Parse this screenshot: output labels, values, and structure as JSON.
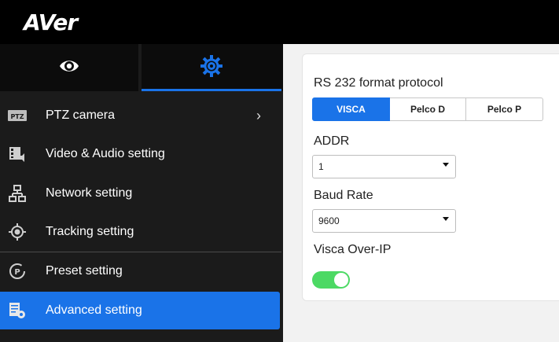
{
  "header": {
    "logo_text": "AVer"
  },
  "mode_tabs": [
    {
      "icon": "eye-icon",
      "active": false
    },
    {
      "icon": "gear-icon",
      "active": true
    }
  ],
  "sidebar": {
    "items": [
      {
        "label": "PTZ camera",
        "icon": "ptz-icon",
        "has_chevron": true
      },
      {
        "label": "Video & Audio setting",
        "icon": "video-audio-icon"
      },
      {
        "label": "Network setting",
        "icon": "network-icon"
      },
      {
        "label": "Tracking setting",
        "icon": "tracking-icon"
      },
      {
        "label": "Preset setting",
        "icon": "preset-icon"
      },
      {
        "label": "Advanced setting",
        "icon": "advanced-setting-icon",
        "active": true
      }
    ],
    "chevron": "›"
  },
  "form": {
    "protocol_label": "RS 232 format protocol",
    "protocol_options": [
      "VISCA",
      "Pelco D",
      "Pelco P"
    ],
    "protocol_selected": "VISCA",
    "addr_label": "ADDR",
    "addr_value": "1",
    "baud_label": "Baud Rate",
    "baud_value": "9600",
    "visca_ip_label": "Visca Over-IP",
    "visca_ip_enabled": true
  },
  "colors": {
    "accent": "#1a73e8",
    "toggle_on": "#4cd964",
    "sidebar_bg": "#1b1b1b"
  }
}
